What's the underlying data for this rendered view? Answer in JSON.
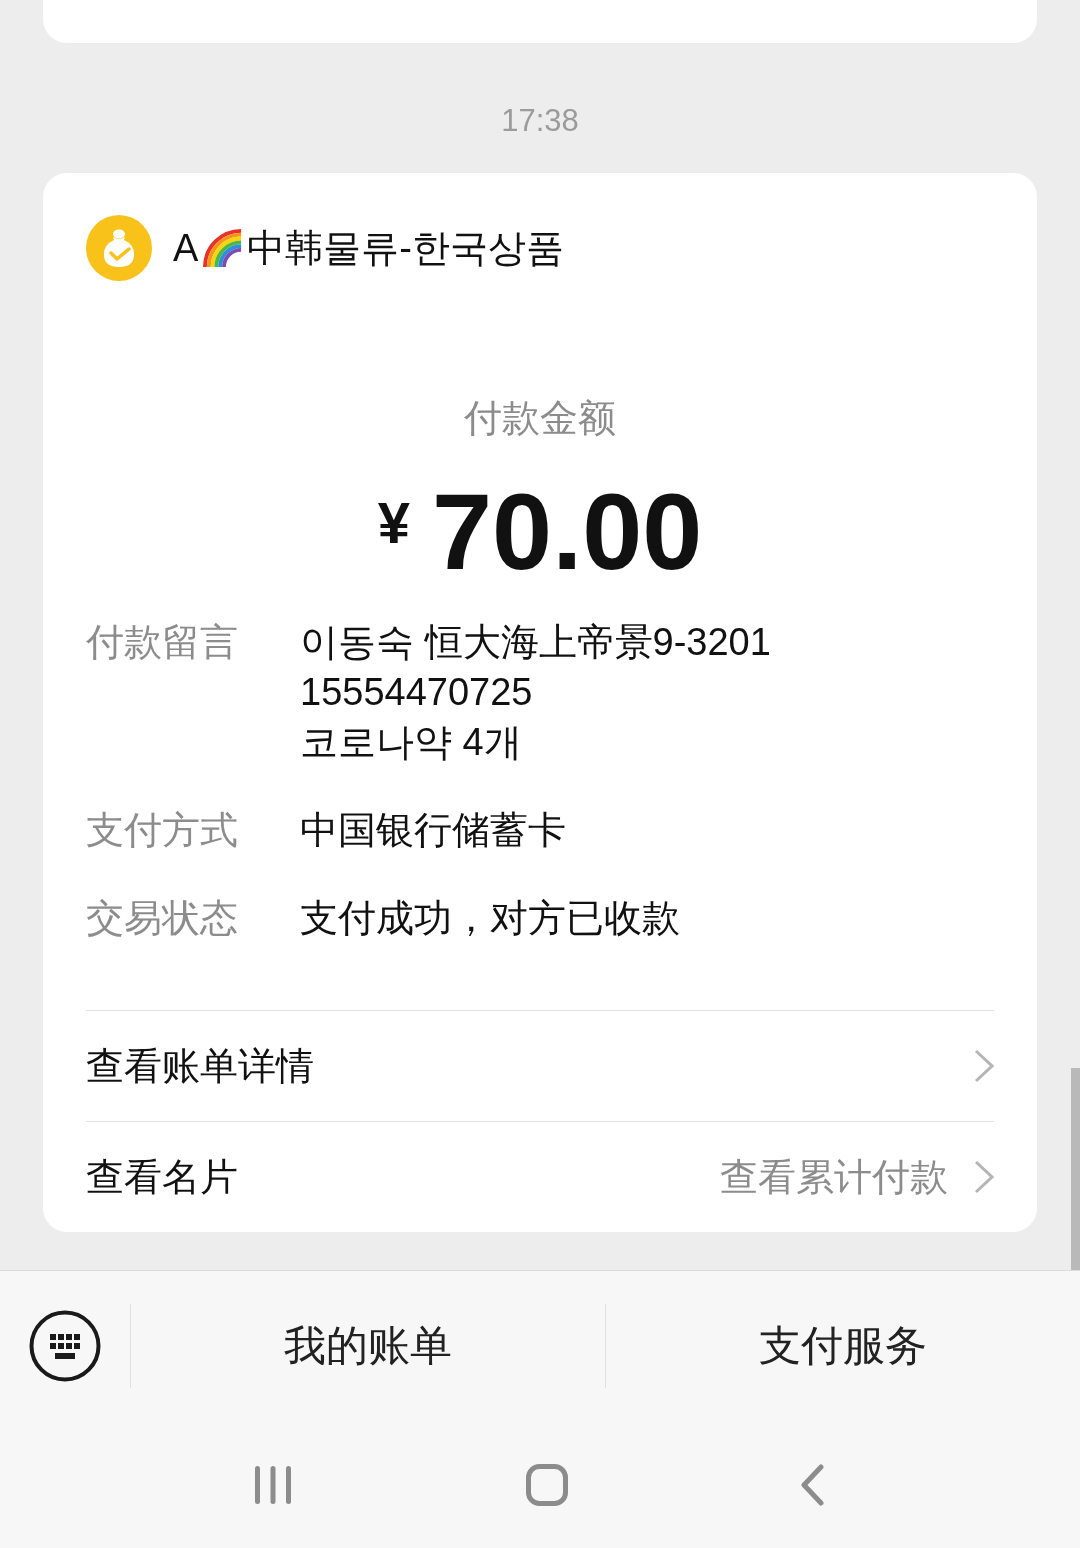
{
  "time": "17:38",
  "payment_card": {
    "merchant": {
      "name_before_emoji": "A",
      "name_after_emoji": "中韩물류-한국상품"
    },
    "amount_label": "付款金额",
    "currency": "¥",
    "amount": "70.00",
    "details": [
      {
        "label": "付款留言",
        "value": "이동숙 恒大海上帝景9-3201\n15554470725\n코로나약 4개"
      },
      {
        "label": "支付方式",
        "value": "中国银行储蓄卡"
      },
      {
        "label": "交易状态",
        "value": "支付成功，对方已收款"
      }
    ],
    "links": [
      {
        "label": "查看账单详情"
      },
      {
        "label": "查看名片",
        "extra": "查看累计付款"
      }
    ]
  },
  "bottom_menu": {
    "items": [
      "我的账单",
      "支付服务"
    ]
  }
}
